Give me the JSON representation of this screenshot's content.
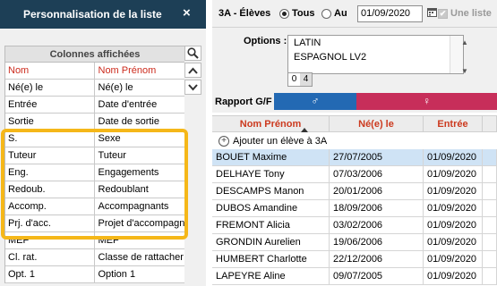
{
  "panel": {
    "title": "Personnalisation de la liste",
    "close_label": "×",
    "columns_header": "Colonnes affichées",
    "col_headers": [
      "Nom",
      "Nom Prénom"
    ],
    "rows": [
      [
        "Né(e) le",
        "Né(e) le"
      ],
      [
        "Entrée",
        "Date d'entrée"
      ],
      [
        "Sortie",
        "Date de sortie"
      ],
      [
        "S.",
        "Sexe"
      ],
      [
        "Tuteur",
        "Tuteur"
      ],
      [
        "Eng.",
        "Engagements"
      ],
      [
        "Redoub.",
        "Redoublant"
      ],
      [
        "Accomp.",
        "Accompagnants"
      ],
      [
        "Prj. d'acc.",
        "Projet d'accompagn"
      ],
      [
        "MEF",
        "MEF"
      ],
      [
        "Cl. rat.",
        "Classe de rattacher"
      ],
      [
        "Opt. 1",
        "Option 1"
      ]
    ]
  },
  "toolbar": {
    "class_label": "3A - Élèves",
    "radio_all": "Tous",
    "radio_at": "Au",
    "date_value": "01/09/2020",
    "unique_label": "Une liste"
  },
  "options": {
    "label": "Options :",
    "items": [
      "LATIN",
      "ESPAGNOL LV2"
    ],
    "tab_a": "0",
    "tab_b": "4"
  },
  "rapport": {
    "label": "Rapport G/F :",
    "boy_symbol": "♂",
    "girl_symbol": "♀"
  },
  "table": {
    "headers": [
      "Nom Prénom",
      "Né(e) le",
      "Entrée"
    ],
    "add_label": "Ajouter un élève à 3A",
    "rows": [
      [
        "BOUET Maxime",
        "27/07/2005",
        "01/09/2020"
      ],
      [
        "DELHAYE Tony",
        "07/03/2006",
        "01/09/2020"
      ],
      [
        "DESCAMPS Manon",
        "20/01/2006",
        "01/09/2020"
      ],
      [
        "DUBOS Amandine",
        "18/09/2006",
        "01/09/2020"
      ],
      [
        "FREMONT Alicia",
        "03/02/2006",
        "01/09/2020"
      ],
      [
        "GRONDIN Aurelien",
        "19/06/2006",
        "01/09/2020"
      ],
      [
        "HUMBERT Charlotte",
        "22/12/2006",
        "01/09/2020"
      ],
      [
        "LAPEYRE Aline",
        "09/07/2005",
        "01/09/2020"
      ]
    ]
  },
  "colors": {
    "header_bg": "#1d3f56",
    "highlight": "#f5b719",
    "accent_red": "#cc2b1d",
    "boy_bar": "#2369b3",
    "girl_bar": "#c72e5a",
    "selected_row": "#cfe3f5"
  }
}
